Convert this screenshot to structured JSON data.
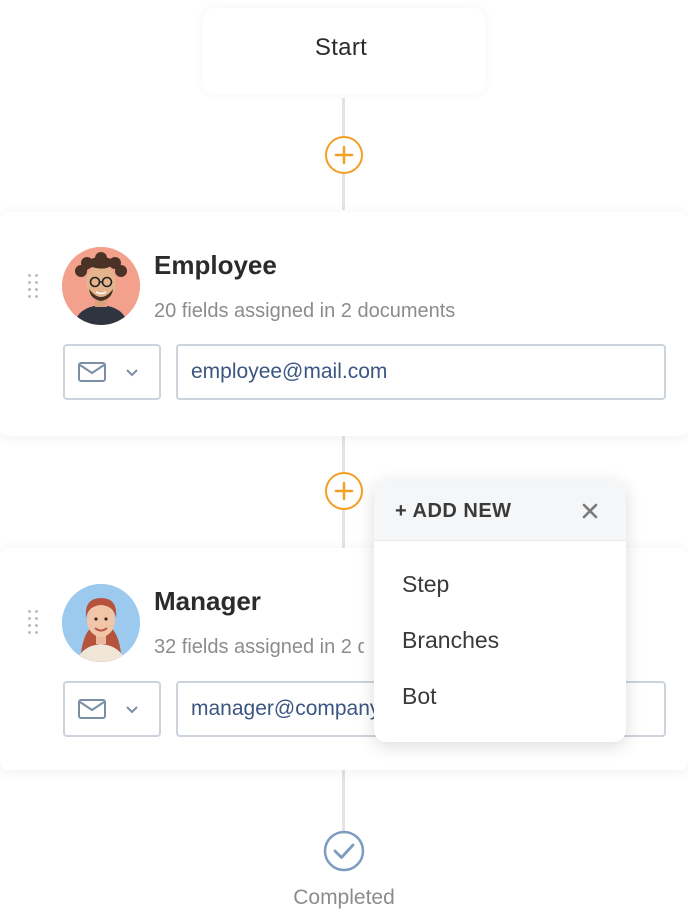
{
  "start": {
    "label": "Start"
  },
  "steps": [
    {
      "title": "Employee",
      "subtitle": "20 fields assigned in 2 documents",
      "email": "employee@mail.com",
      "avatar_color": "#f3a08c"
    },
    {
      "title": "Manager",
      "subtitle": "32 fields assigned in 2 documents",
      "email": "manager@company.com",
      "avatar_color": "#9cc9ee"
    }
  ],
  "add_menu": {
    "title": "+ ADD NEW",
    "items": [
      "Step",
      "Branches",
      "Bot"
    ]
  },
  "end": {
    "label": "Completed"
  },
  "colors": {
    "accent_add": "#f2a024",
    "completed_check": "#7c9cc1",
    "email_text": "#3b5680"
  },
  "icons": {
    "add": "plus-circle-icon",
    "delivery": "envelope-icon",
    "dropdown": "chevron-down-icon",
    "close": "close-icon",
    "completed": "check-circle-icon",
    "drag": "drag-handle-icon"
  }
}
